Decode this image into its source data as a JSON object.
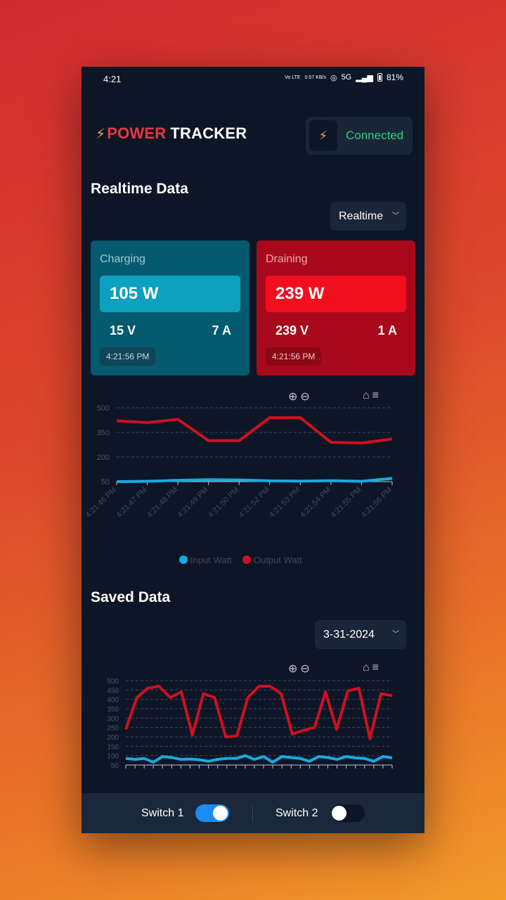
{
  "status_bar": {
    "time": "4:21",
    "net_speed": "0.57 KB/s",
    "network": "5G",
    "battery": "81%",
    "volte": "Vo LTE"
  },
  "header": {
    "logo_part1": "POWER",
    "logo_part2": "TRACKER",
    "connection_status": "Connected"
  },
  "realtime": {
    "title": "Realtime Data",
    "mode": "Realtime",
    "charging": {
      "title": "Charging",
      "watts": "105 W",
      "volts": "15 V",
      "amps": "7 A",
      "timestamp": "4:21:56 PM"
    },
    "draining": {
      "title": "Draining",
      "watts": "239 W",
      "volts": "239 V",
      "amps": "1 A",
      "timestamp": "4:21:56 PM"
    }
  },
  "saved": {
    "title": "Saved Data",
    "date": "3-31-2024"
  },
  "switches": {
    "switch1_label": "Switch 1",
    "switch1_on": true,
    "switch2_label": "Switch 2",
    "switch2_on": false
  },
  "colors": {
    "input": "#1aa9e0",
    "output": "#d0101f",
    "connected": "#2fd37a"
  },
  "chart_data": [
    {
      "type": "line",
      "y_ticks": [
        "50",
        "200",
        "350",
        "500"
      ],
      "ylim": [
        50,
        500
      ],
      "x": [
        "4:21:46 PM",
        "4:21:47 PM",
        "4:21:48 PM",
        "4:21:49 PM",
        "4:21:50 PM",
        "4:21:52 PM",
        "4:21:53 PM",
        "4:21:54 PM",
        "4:21:55 PM",
        "4:21:56 PM"
      ],
      "series": [
        {
          "name": "Input Watt",
          "values": [
            50,
            52,
            58,
            62,
            60,
            55,
            53,
            56,
            52,
            70
          ]
        },
        {
          "name": "Output Watt",
          "values": [
            420,
            410,
            430,
            300,
            300,
            440,
            440,
            290,
            285,
            310
          ]
        }
      ],
      "legend": "bottom"
    },
    {
      "type": "line",
      "y_ticks": [
        "50",
        "100",
        "150",
        "200",
        "250",
        "300",
        "350",
        "400",
        "450",
        "500"
      ],
      "ylim": [
        50,
        500
      ],
      "x_count": 30,
      "series": [
        {
          "name": "Input Watt",
          "values": [
            85,
            80,
            85,
            65,
            95,
            90,
            80,
            82,
            78,
            70,
            80,
            85,
            85,
            100,
            80,
            95,
            65,
            95,
            90,
            85,
            70,
            95,
            90,
            80,
            95,
            88,
            85,
            70,
            95,
            88
          ]
        },
        {
          "name": "Output Watt",
          "values": [
            240,
            410,
            460,
            470,
            410,
            440,
            210,
            430,
            410,
            200,
            205,
            410,
            470,
            470,
            430,
            215,
            235,
            250,
            440,
            240,
            445,
            460,
            190,
            430,
            420
          ]
        }
      ],
      "legend": "none"
    }
  ]
}
